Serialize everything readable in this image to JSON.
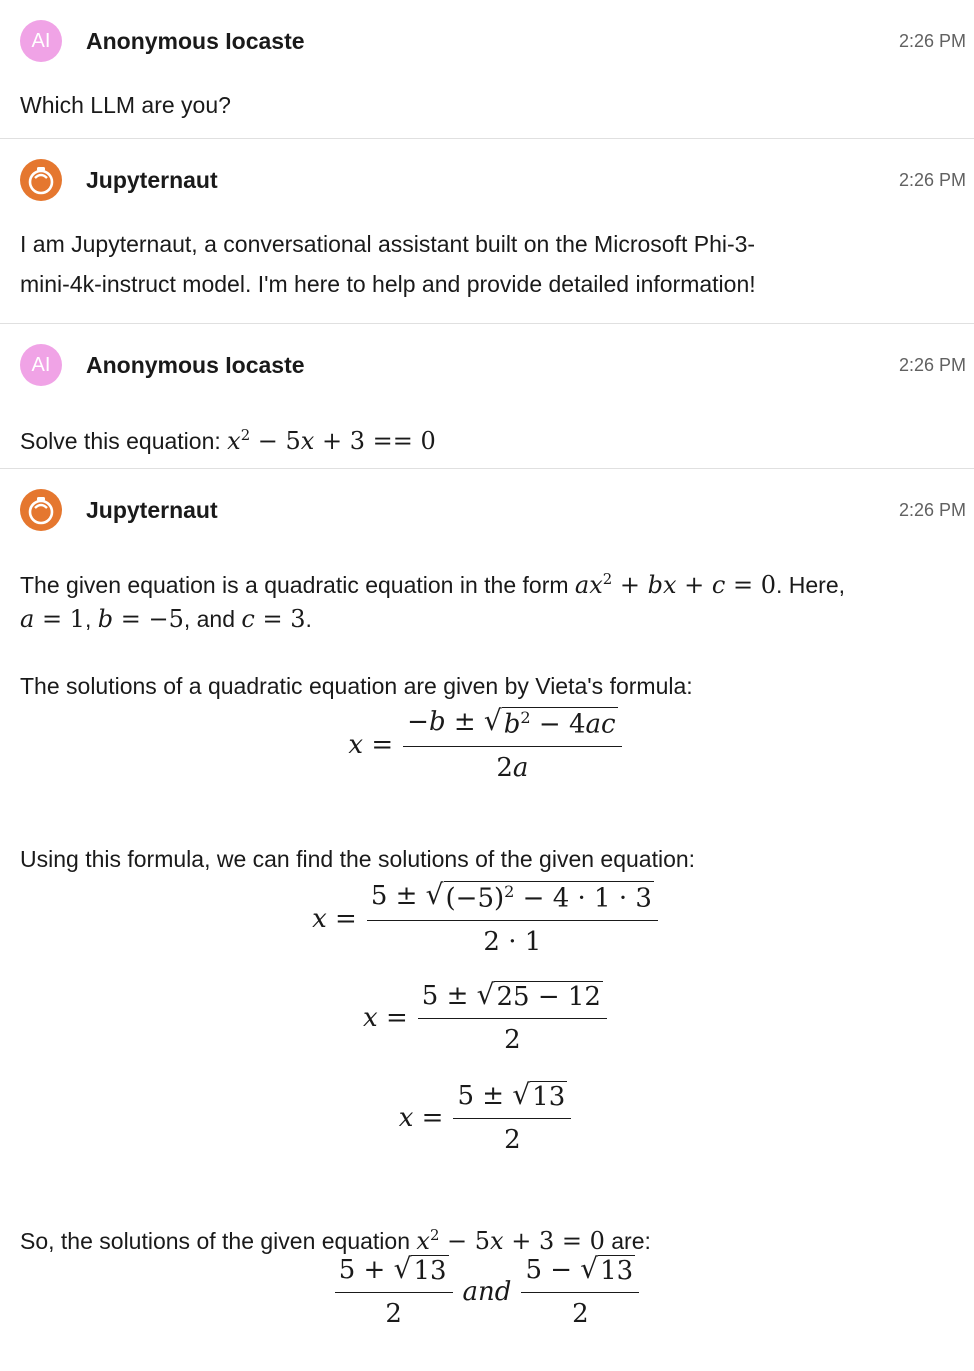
{
  "messages": [
    {
      "author": "Anonymous Iocaste",
      "avatar_text": "AI",
      "time": "2:26 PM"
    },
    {
      "author": "Jupyternaut",
      "time": "2:26 PM"
    },
    {
      "author": "Anonymous Iocaste",
      "avatar_text": "AI",
      "time": "2:26 PM"
    },
    {
      "author": "Jupyternaut",
      "time": "2:26 PM"
    }
  ],
  "text": {
    "q1": "Which LLM are you?",
    "a1_line1": "I am Jupyternaut, a conversational assistant built on the Microsoft Phi-3-",
    "a1_line2": "mini-4k-instruct model. I'm here to help and provide detailed information!",
    "q2_prefix": "Solve this equation: ",
    "a2_p1_prefix": "The given equation is a quadratic equation in the form ",
    "a2_p1_suffix": ". Here,",
    "a2_and": ", and ",
    "a2_p2": "The solutions of a quadratic equation are given by Vieta's formula:",
    "a2_p3": "Using this formula, we can find the solutions of the given equation:",
    "a2_p4_prefix": "So, the solutions of the given equation ",
    "a2_p4_suffix": " are:",
    "and_word": "and"
  },
  "colors": {
    "user_avatar": "#f0a3e6",
    "bot_avatar": "#e5772f",
    "divider": "#e0e0e0"
  },
  "icons": {
    "bot_avatar": "jupyternaut-icon"
  }
}
